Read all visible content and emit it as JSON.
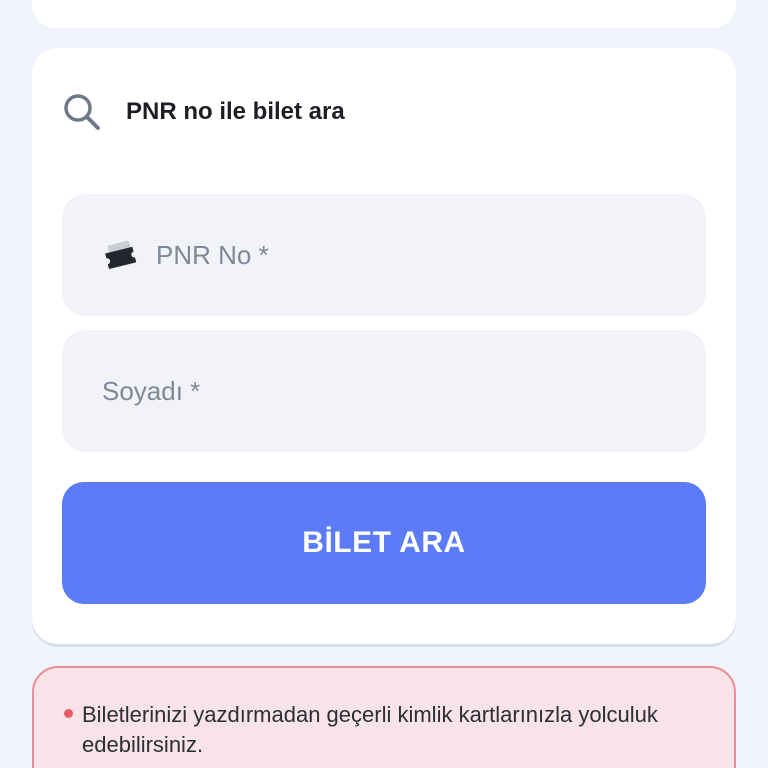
{
  "search_card": {
    "title": "PNR no ile bilet ara",
    "pnr_field": {
      "placeholder": "PNR No *",
      "value": "",
      "icon": "ticket-icon"
    },
    "surname_field": {
      "placeholder": "Soyadı *",
      "value": ""
    },
    "search_button_label": "BİLET ARA",
    "header_icon": "search-icon"
  },
  "notice": {
    "text": "Biletlerinizi yazdırmadan geçerli kimlik kartlarınızla yolculuk edebilirsiniz."
  },
  "colors": {
    "background": "#f1f4fb",
    "card": "#ffffff",
    "field": "#f1f3f9",
    "button": "#5b7cf6",
    "notice_background": "#f7e3e8",
    "notice_border": "#ea8d97",
    "notice_bullet": "#e75b66"
  }
}
